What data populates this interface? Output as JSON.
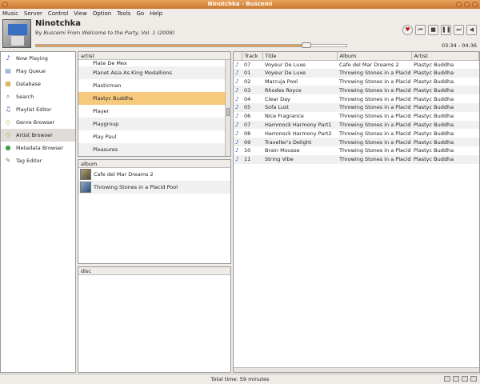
{
  "window": {
    "title": "Ninotchka - Buscemi"
  },
  "menu": [
    "Music",
    "Server",
    "Control",
    "View",
    "Option",
    "Tools",
    "Go",
    "Help"
  ],
  "now_playing": {
    "title": "Ninotchka",
    "by_prefix": "By",
    "artist": "Buscemi",
    "from_prefix": "From",
    "album": "Welcome to the Party, Vol. 1 (2008)",
    "progress_fraction": 0.87,
    "time": "03:34 - 04:36"
  },
  "controls": [
    {
      "name": "love-button",
      "glyph": "♥"
    },
    {
      "name": "previous-button",
      "glyph": "⏮"
    },
    {
      "name": "stop-button",
      "glyph": "■"
    },
    {
      "name": "pause-button",
      "glyph": "❚❚"
    },
    {
      "name": "next-button",
      "glyph": "⏭"
    },
    {
      "name": "volume-button",
      "glyph": "◀"
    }
  ],
  "sidebar": {
    "items": [
      {
        "label": "Now Playing",
        "icon": "music-note-icon",
        "glyph": "♪",
        "color": "#2d55a8"
      },
      {
        "label": "Play Queue",
        "icon": "queue-icon",
        "glyph": "▤",
        "color": "#5a7ab8"
      },
      {
        "label": "Database",
        "icon": "database-icon",
        "glyph": "▦",
        "color": "#c99a20"
      },
      {
        "label": "Search",
        "icon": "search-icon",
        "glyph": "⌕",
        "color": "#555"
      },
      {
        "label": "Playlist Editor",
        "icon": "playlist-icon",
        "glyph": "♫",
        "color": "#2d55a8"
      },
      {
        "label": "Genre Browser",
        "icon": "tag-icon",
        "glyph": "◇",
        "color": "#9ab040"
      },
      {
        "label": "Artist Browser",
        "icon": "artist-icon",
        "glyph": "◇",
        "color": "#9ab040"
      },
      {
        "label": "Metadata Browser",
        "icon": "metadata-icon",
        "glyph": "●",
        "color": "#40a040"
      },
      {
        "label": "Tag Editor",
        "icon": "tag-editor-icon",
        "glyph": "✎",
        "color": "#a07040"
      }
    ],
    "selected_index": 6
  },
  "artist_panel": {
    "header": "artist",
    "partial_item": "Plate De Mex",
    "items": [
      "Planet Asia As King Medallions",
      "Plasticman",
      "Plastyc Buddha",
      "Player",
      "Playgroup",
      "Play Paul",
      "Pleasures"
    ],
    "selected_index": 2
  },
  "album_panel": {
    "header": "album",
    "items": [
      "Cafe del Mar Dreams 2",
      "Throwing Stones in a Placid Pool"
    ]
  },
  "disc_panel": {
    "header": "disc"
  },
  "tracks": {
    "columns": [
      "Track",
      "Title",
      "Album",
      "Artist"
    ],
    "rows": [
      {
        "track": "07",
        "title": "Voyeur De Luxe",
        "album": "Cafe del Mar Dreams 2",
        "artist": "Plastyc Buddha"
      },
      {
        "track": "01",
        "title": "Voyeur De Luxe",
        "album": "Throwing Stones in a Placid",
        "artist": "Plastyc Buddha"
      },
      {
        "track": "02",
        "title": "Marcuja Pool",
        "album": "Throwing Stones in a Placid",
        "artist": "Plastyc Buddha"
      },
      {
        "track": "03",
        "title": "Rhodes Royce",
        "album": "Throwing Stones in a Placid",
        "artist": "Plastyc Buddha"
      },
      {
        "track": "04",
        "title": "Clear Day",
        "album": "Throwing Stones in a Placid",
        "artist": "Plastyc Buddha"
      },
      {
        "track": "05",
        "title": "Sofa Lust",
        "album": "Throwing Stones in a Placid",
        "artist": "Plastyc Buddha"
      },
      {
        "track": "06",
        "title": "Nice Fragrance",
        "album": "Throwing Stones in a Placid",
        "artist": "Plastyc Buddha"
      },
      {
        "track": "07",
        "title": "Hammock Harmony Part1",
        "album": "Throwing Stones in a Placid",
        "artist": "Plastyc Buddha"
      },
      {
        "track": "08",
        "title": "Hammock Harmony Part2",
        "album": "Throwing Stones in a Placid",
        "artist": "Plastyc Buddha"
      },
      {
        "track": "09",
        "title": "Traveller's Delight",
        "album": "Throwing Stones in a Placid",
        "artist": "Plastyc Buddha"
      },
      {
        "track": "10",
        "title": "Brain Mousse",
        "album": "Throwing Stones in a Placid",
        "artist": "Plastyc Buddha"
      },
      {
        "track": "11",
        "title": "String Vibe",
        "album": "Throwing Stones in a Placid",
        "artist": "Plastyc Buddha"
      }
    ]
  },
  "status": {
    "total_time": "Total time: 59 minutes"
  }
}
